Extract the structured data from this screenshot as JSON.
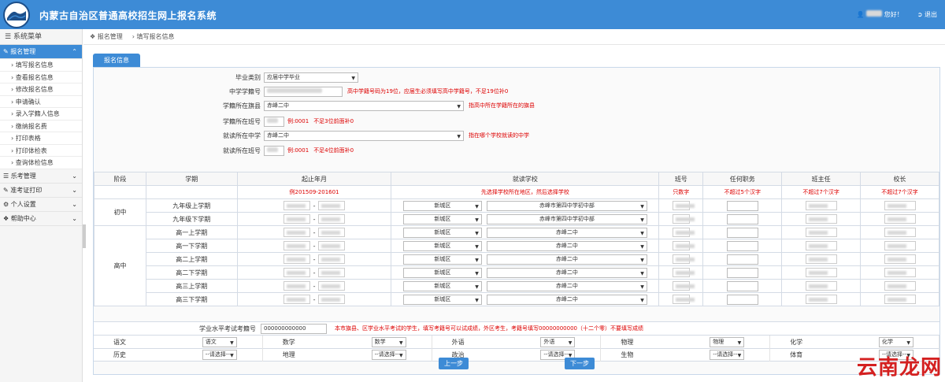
{
  "app": {
    "title": "内蒙古自治区普通高校招生网上报名系统",
    "greeting": "您好！",
    "exit": "退出"
  },
  "sidebar": {
    "header": "系统菜单",
    "groups": [
      {
        "label": "报名管理",
        "active": true,
        "items": [
          "填写报名信息",
          "查看报名信息",
          "修改报名信息",
          "申请确认",
          "录入学籍人信息",
          "缴纳报名费",
          "打印表格",
          "打印体检表",
          "查询体检信息"
        ]
      },
      {
        "label": "乐考管理",
        "active": false
      },
      {
        "label": "准考证打印",
        "active": false
      },
      {
        "label": "个人设置",
        "active": false
      },
      {
        "label": "帮助中心",
        "active": false
      }
    ]
  },
  "breadcrumb": {
    "home": "报名管理",
    "current": "填写报名信息"
  },
  "tab": "报名信息",
  "form": {
    "graduate_type": {
      "label": "毕业类别",
      "value": "应届中学毕业"
    },
    "school_id": {
      "label": "中学学籍号",
      "hint": "高中学籍号码为19位，应届生必须填写高中学籍号，不足19位补0"
    },
    "school_region": {
      "label": "学籍所在旗县",
      "value": "赤峰二中",
      "hint": "指高中所在学籍所在的旗县"
    },
    "school_class": {
      "label": "学籍所在班号",
      "value": "例:0001",
      "hint": "不足3位前面补0"
    },
    "current_school": {
      "label": "就读所在中学",
      "value": "赤峰二中",
      "hint": "指在哪个学校就读的中学"
    },
    "current_class": {
      "label": "就读所在班号",
      "value": "例:0001",
      "hint": "不足4位前面补0"
    }
  },
  "history": {
    "headers": [
      "阶段",
      "学期",
      "起止年月",
      "就读学校",
      "班号",
      "任何职务",
      "班主任",
      "校长"
    ],
    "hints": [
      "",
      "",
      "例201509-201601",
      "先选择学校所在地区，然后选择学校",
      "只数字",
      "不超过5个汉字",
      "不超过7个汉字",
      "不超过7个汉字"
    ],
    "stages": [
      {
        "name": "初中",
        "rows": [
          {
            "term": "九年级上学期",
            "district": "新城区",
            "school": "赤峰市第四中学初中部"
          },
          {
            "term": "九年级下学期",
            "district": "新城区",
            "school": "赤峰市第四中学初中部"
          }
        ]
      },
      {
        "name": "高中",
        "rows": [
          {
            "term": "高一上学期",
            "district": "新城区",
            "school": "赤峰二中"
          },
          {
            "term": "高一下学期",
            "district": "新城区",
            "school": "赤峰二中"
          },
          {
            "term": "高二上学期",
            "district": "新城区",
            "school": "赤峰二中"
          },
          {
            "term": "高二下学期",
            "district": "新城区",
            "school": "赤峰二中"
          },
          {
            "term": "高三上学期",
            "district": "新城区",
            "school": "赤峰二中"
          },
          {
            "term": "高三下学期",
            "district": "新城区",
            "school": "赤峰二中"
          }
        ]
      }
    ]
  },
  "exam": {
    "label": "学业水平考试考籍号",
    "value": "000000000000",
    "hint": "本市旗县、区学业水平考试的学生，填写考籍号可以试成绩，外区考生，考籍号填写00000000000（十二个零）不要填写成绩",
    "row1": [
      {
        "subject": "语文",
        "value": "语文"
      },
      {
        "subject": "数学",
        "value": "数学"
      },
      {
        "subject": "外语",
        "value": "外语"
      },
      {
        "subject": "物理",
        "value": "物理"
      },
      {
        "subject": "化学",
        "value": "化学"
      }
    ],
    "row2": [
      {
        "subject": "历史",
        "value": "--请选择--"
      },
      {
        "subject": "地理",
        "value": "--请选择--"
      },
      {
        "subject": "政治",
        "value": "--请选择--"
      },
      {
        "subject": "生物",
        "value": "--请选择--"
      },
      {
        "subject": "体育",
        "value": "--请选择--"
      }
    ]
  },
  "buttons": {
    "prev": "上一步",
    "next": "下一步"
  },
  "watermark": "云南龙网"
}
